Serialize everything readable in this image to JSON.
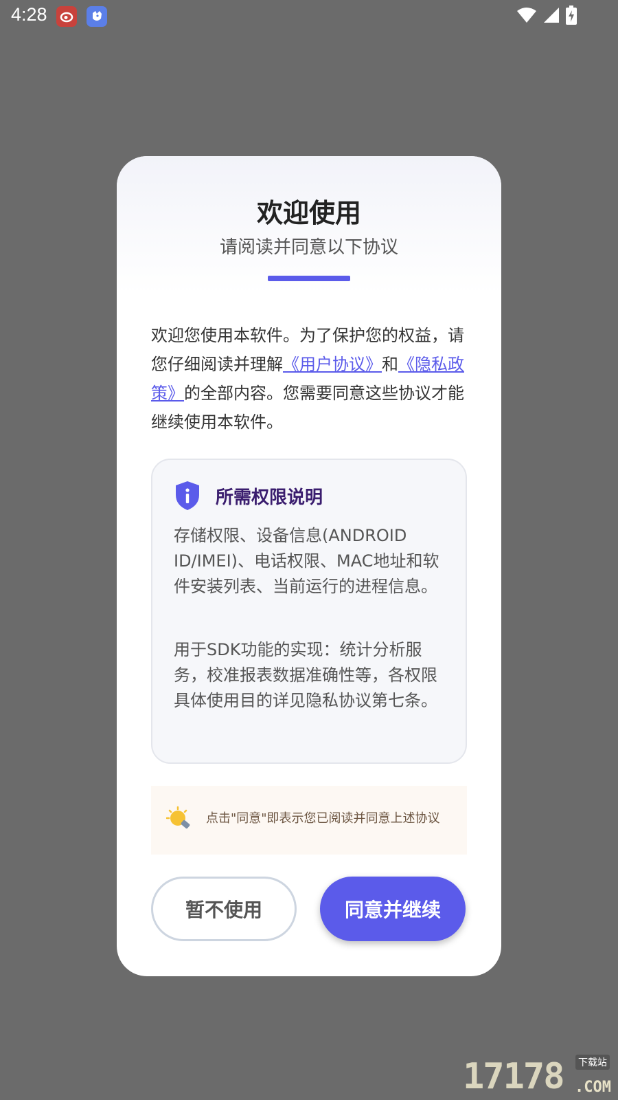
{
  "status_bar": {
    "time": "4:28",
    "notification_icons": [
      "weibo-icon",
      "bird-app-icon"
    ],
    "system_icons": [
      "wifi-icon",
      "signal-icon",
      "battery-charging-icon"
    ]
  },
  "dialog": {
    "title": "欢迎使用",
    "subtitle": "请阅读并同意以下协议",
    "accent_color": "#5b5bea",
    "intro": {
      "part1": "欢迎您使用本软件。为了保护您的权益，请您仔细阅读并理解",
      "user_agreement_link": "《用户协议》",
      "part2": "和",
      "privacy_policy_link": "《隐私政策》",
      "part3": "的全部内容。您需要同意这些协议才能继续使用本软件。"
    },
    "permissions": {
      "icon": "shield-info-icon",
      "title": "所需权限说明",
      "paragraph1": "存储权限、设备信息(ANDROID ID/IMEI)、电话权限、MAC地址和软件安装列表、当前运行的进程信息。",
      "paragraph2": "用于SDK功能的实现：统计分析服务，校准报表数据准确性等，各权限具体使用目的详见隐私协议第七条。"
    },
    "tip": {
      "icon": "lightbulb-icon",
      "text": "点击\"同意\"即表示您已阅读并同意上述协议"
    },
    "buttons": {
      "decline": "暂不使用",
      "agree": "同意并继续"
    }
  },
  "watermark": {
    "digits": "17178",
    "label": "下载站",
    "domain": ".COM"
  }
}
